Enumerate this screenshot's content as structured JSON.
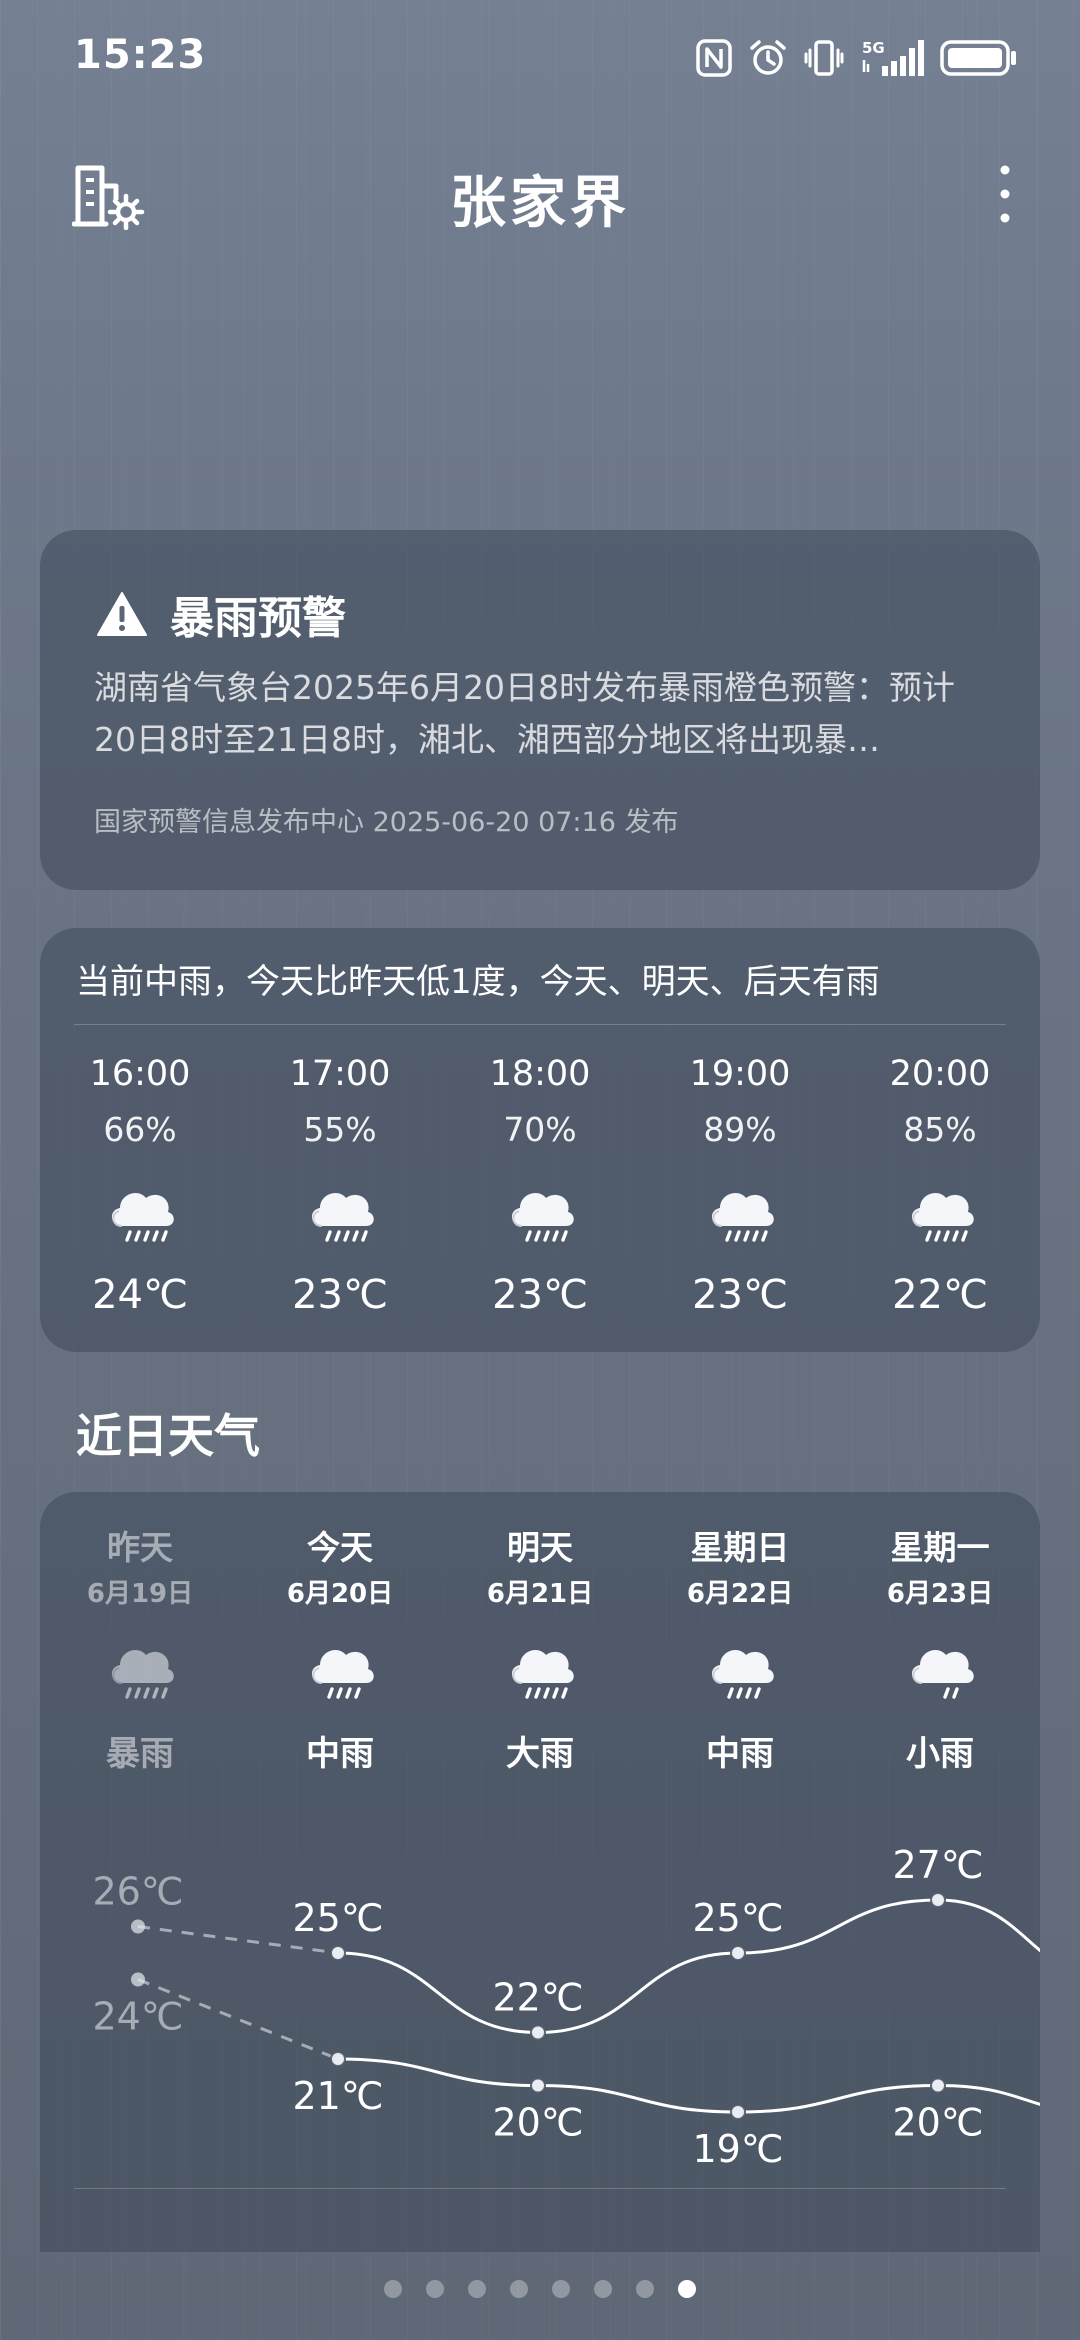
{
  "status_bar": {
    "time": "15:23",
    "network": "5G",
    "icons": [
      "nfc-icon",
      "alarm-icon",
      "vibrate-icon",
      "signal-5g-icon",
      "battery-icon"
    ]
  },
  "header": {
    "city": "张家界",
    "left_icon": "city-manage-icon",
    "right_icon": "more-icon"
  },
  "alert": {
    "title": "暴雨预警",
    "body": "湖南省气象台2025年6月20日8时发布暴雨橙色预警：预计20日8时至21日8时，湘北、湘西部分地区将出现暴…",
    "source": "国家预警信息发布中心 2025-06-20 07:16 发布",
    "icon": "warning-icon"
  },
  "hourly": {
    "summary": "当前中雨，今天比昨天低1度，今天、明天、后天有雨",
    "items": [
      {
        "time": "16:00",
        "pop": "66%",
        "icon": "rain-cloud-icon",
        "temp": "24℃"
      },
      {
        "time": "17:00",
        "pop": "55%",
        "icon": "rain-cloud-icon",
        "temp": "23℃"
      },
      {
        "time": "18:00",
        "pop": "70%",
        "icon": "rain-cloud-icon",
        "temp": "23℃"
      },
      {
        "time": "19:00",
        "pop": "89%",
        "icon": "rain-cloud-icon",
        "temp": "23℃"
      },
      {
        "time": "20:00",
        "pop": "85%",
        "icon": "rain-cloud-icon",
        "temp": "22℃"
      }
    ]
  },
  "daily": {
    "section_title": "近日天气",
    "days": [
      {
        "name": "昨天",
        "date": "6月19日",
        "condition": "暴雨",
        "icon": "heavy-rain-icon",
        "high": 26,
        "low": 24,
        "high_label": "26℃",
        "low_label": "24℃",
        "past": true
      },
      {
        "name": "今天",
        "date": "6月20日",
        "condition": "中雨",
        "icon": "moderate-rain-icon",
        "high": 25,
        "low": 21,
        "high_label": "25℃",
        "low_label": "21℃",
        "past": false
      },
      {
        "name": "明天",
        "date": "6月21日",
        "condition": "大雨",
        "icon": "heavy-rain-icon",
        "high": 22,
        "low": 20,
        "high_label": "22℃",
        "low_label": "20℃",
        "past": false
      },
      {
        "name": "星期日",
        "date": "6月22日",
        "condition": "中雨",
        "icon": "moderate-rain-icon",
        "high": 25,
        "low": 19,
        "high_label": "25℃",
        "low_label": "19℃",
        "past": false
      },
      {
        "name": "星期一",
        "date": "6月23日",
        "condition": "小雨",
        "icon": "light-rain-icon",
        "high": 27,
        "low": 20,
        "high_label": "27℃",
        "low_label": "20℃",
        "past": false
      }
    ]
  },
  "pager": {
    "count": 8,
    "active": 7
  },
  "colors": {
    "background": "#6e798b",
    "card": "#3e485a",
    "text": "#ffffff"
  }
}
